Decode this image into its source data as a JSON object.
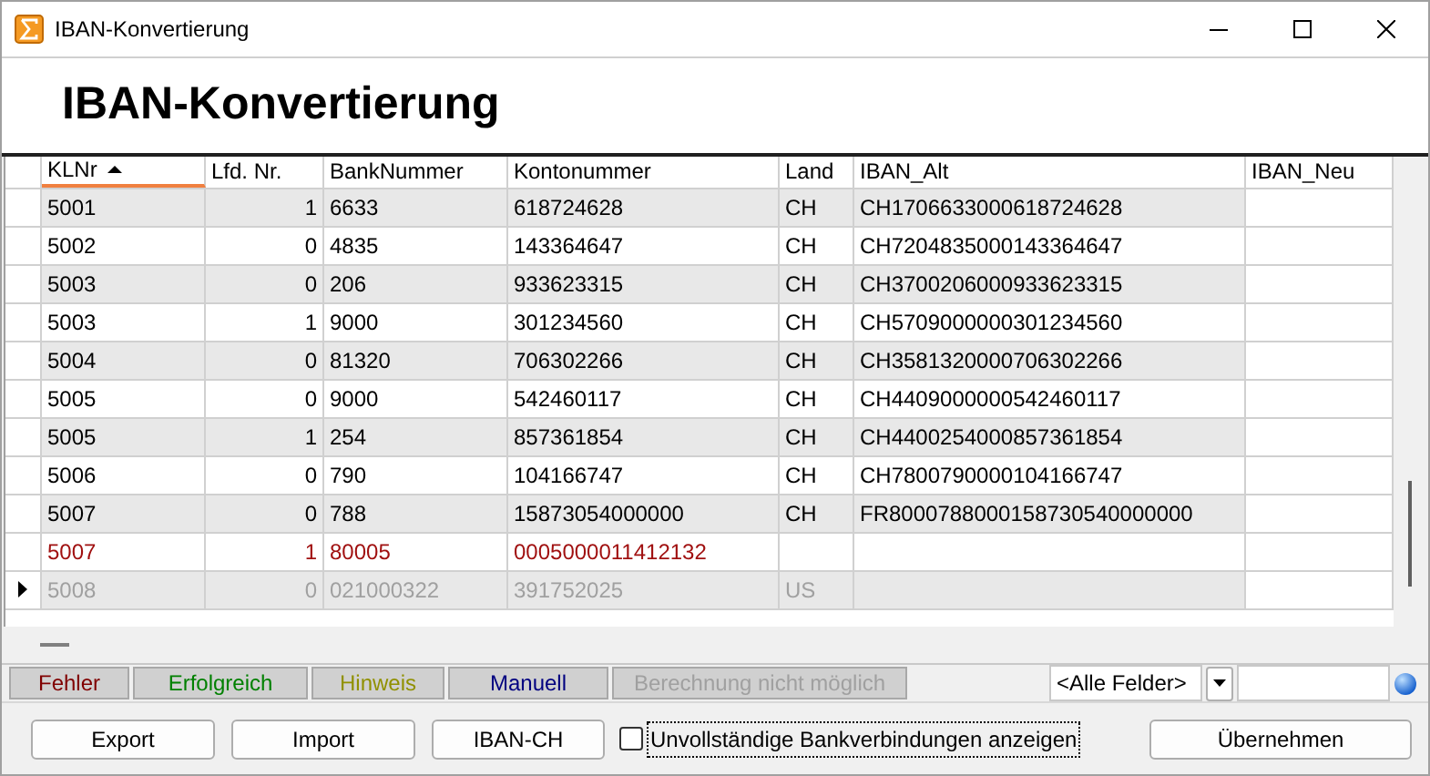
{
  "window": {
    "title": "IBAN-Konvertierung"
  },
  "header": {
    "title": "IBAN-Konvertierung"
  },
  "table": {
    "columns": [
      {
        "label": "KLNr",
        "sorted": true
      },
      {
        "label": "Lfd. Nr.",
        "sorted": false
      },
      {
        "label": "BankNummer",
        "sorted": false
      },
      {
        "label": "Kontonummer",
        "sorted": false
      },
      {
        "label": "Land",
        "sorted": false
      },
      {
        "label": "IBAN_Alt",
        "sorted": false
      },
      {
        "label": "IBAN_Neu",
        "sorted": false
      }
    ],
    "rows": [
      {
        "kind": "normal",
        "current": false,
        "cells": [
          "5001",
          "1",
          "6633",
          "618724628",
          "CH",
          "CH1706633000618724628",
          ""
        ]
      },
      {
        "kind": "normal",
        "current": false,
        "cells": [
          "5002",
          "0",
          "4835",
          "143364647",
          "CH",
          "CH7204835000143364647",
          ""
        ]
      },
      {
        "kind": "normal",
        "current": false,
        "cells": [
          "5003",
          "0",
          "206",
          "933623315",
          "CH",
          "CH3700206000933623315",
          ""
        ]
      },
      {
        "kind": "normal",
        "current": false,
        "cells": [
          "5003",
          "1",
          "9000",
          "301234560",
          "CH",
          "CH5709000000301234560",
          ""
        ]
      },
      {
        "kind": "normal",
        "current": false,
        "cells": [
          "5004",
          "0",
          "81320",
          "706302266",
          "CH",
          "CH3581320000706302266",
          ""
        ]
      },
      {
        "kind": "normal",
        "current": false,
        "cells": [
          "5005",
          "0",
          "9000",
          "542460117",
          "CH",
          "CH4409000000542460117",
          ""
        ]
      },
      {
        "kind": "normal",
        "current": false,
        "cells": [
          "5005",
          "1",
          "254",
          "857361854",
          "CH",
          "CH4400254000857361854",
          ""
        ]
      },
      {
        "kind": "normal",
        "current": false,
        "cells": [
          "5006",
          "0",
          "790",
          "104166747",
          "CH",
          "CH7800790000104166747",
          ""
        ]
      },
      {
        "kind": "normal",
        "current": false,
        "cells": [
          "5007",
          "0",
          "788",
          "15873054000000",
          "CH",
          "FR8000788000158730540000000",
          ""
        ]
      },
      {
        "kind": "error",
        "current": false,
        "cells": [
          "5007",
          "1",
          "80005",
          "0005000011412132",
          "",
          "",
          ""
        ]
      },
      {
        "kind": "impossible",
        "current": true,
        "cells": [
          "5008",
          "0",
          "021000322",
          "391752025",
          "US",
          "",
          ""
        ]
      }
    ]
  },
  "legend": [
    {
      "label": "Fehler",
      "kind": "error"
    },
    {
      "label": "Erfolgreich",
      "kind": "success"
    },
    {
      "label": "Hinweis",
      "kind": "hint"
    },
    {
      "label": "Manuell",
      "kind": "manual"
    },
    {
      "label": "Berechnung nicht möglich",
      "kind": "impossible"
    }
  ],
  "filter": {
    "field": "<Alle Felder>"
  },
  "buttons": [
    "Export",
    "Import",
    "IBAN-CH"
  ],
  "checkbox": {
    "label": "Unvollständige Bankverbindungen anzeigen",
    "checked": false
  },
  "apply_button": "Übernehmen"
}
